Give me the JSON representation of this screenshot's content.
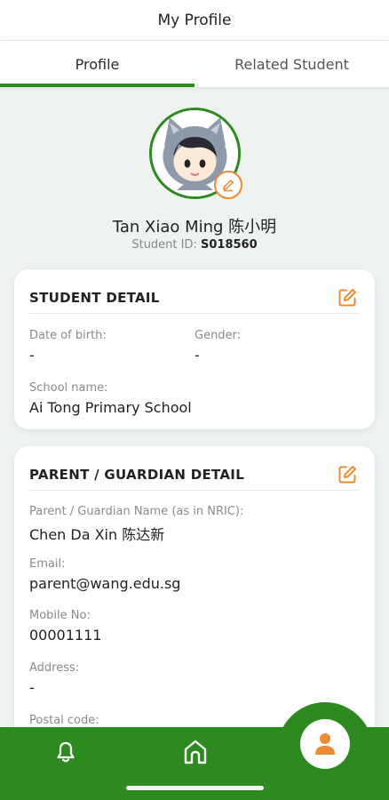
{
  "header": {
    "title": "My Profile"
  },
  "tabs": [
    {
      "label": "Profile",
      "active": true
    },
    {
      "label": "Related Student",
      "active": false
    }
  ],
  "student": {
    "name": "Tan Xiao Ming 陈小明",
    "id_label": "Student ID:",
    "id_value": "S018560"
  },
  "student_detail": {
    "title": "STUDENT DETAIL",
    "dob_label": "Date of birth:",
    "dob_value": "-",
    "gender_label": "Gender:",
    "gender_value": "-",
    "school_label": "School name:",
    "school_value": "Ai Tong Primary School"
  },
  "guardian_detail": {
    "title": "PARENT / GUARDIAN DETAIL",
    "name_label": "Parent / Guardian Name (as in NRIC):",
    "name_value": "Chen Da Xin 陈达新",
    "email_label": "Email:",
    "email_value": "parent@wang.edu.sg",
    "mobile_label": "Mobile No:",
    "mobile_value": "00001111",
    "address_label": "Address:",
    "address_value": "-",
    "postal_label": "Postal code:"
  },
  "colors": {
    "brand_green": "#2c8a1f",
    "accent_orange": "#f08a30"
  },
  "nav": {
    "items": [
      "bell-icon",
      "home-icon",
      "person-icon"
    ],
    "active": "person-icon"
  }
}
